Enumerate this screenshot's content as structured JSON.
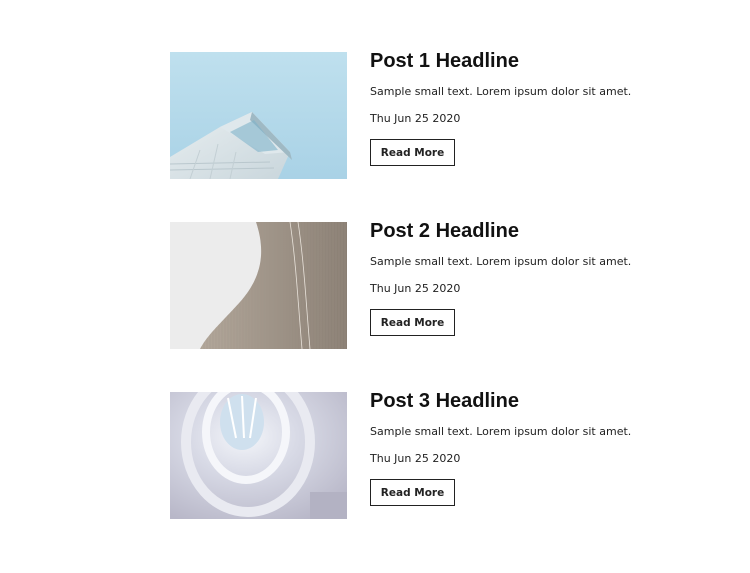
{
  "posts": [
    {
      "headline": "Post 1 Headline",
      "excerpt": "Sample small text. Lorem ipsum dolor sit amet.",
      "date": "Thu Jun 25 2020",
      "button_label": "Read More",
      "image": "building-corner-sky-photo"
    },
    {
      "headline": "Post 2 Headline",
      "excerpt": "Sample small text. Lorem ipsum dolor sit amet.",
      "date": "Thu Jun 25 2020",
      "button_label": "Read More",
      "image": "curved-facade-photo"
    },
    {
      "headline": "Post 3 Headline",
      "excerpt": "Sample small text. Lorem ipsum dolor sit amet.",
      "date": "Thu Jun 25 2020",
      "button_label": "Read More",
      "image": "spiral-staircase-photo"
    }
  ],
  "colors": {
    "text": "#111111",
    "button_border": "#222222",
    "background": "#ffffff"
  }
}
